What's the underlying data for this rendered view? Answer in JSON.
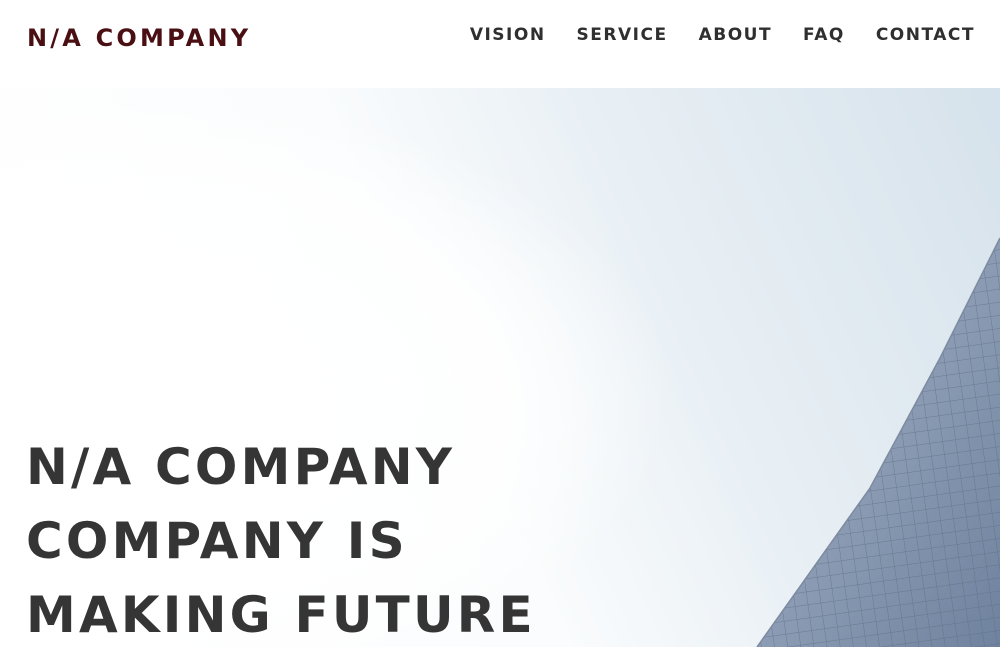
{
  "brand": {
    "name": "N/A COMPANY"
  },
  "nav": {
    "items": [
      {
        "label": "VISION"
      },
      {
        "label": "SERVICE"
      },
      {
        "label": "ABOUT"
      },
      {
        "label": "FAQ"
      },
      {
        "label": "CONTACT"
      }
    ]
  },
  "hero": {
    "heading_lines": [
      "N/A COMPANY",
      "COMPANY IS",
      "MAKING FUTURE"
    ],
    "image": "glass-skyscraper-against-sky"
  },
  "colors": {
    "brand": "#4a0f12",
    "nav_text": "#2f2f2f",
    "heading_text": "#353535",
    "sky": "#d9e4ee",
    "glass": "#8a9bb5"
  }
}
